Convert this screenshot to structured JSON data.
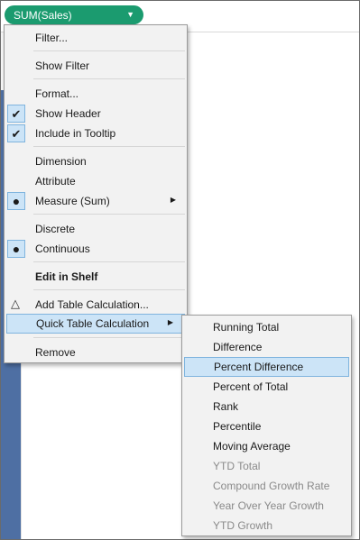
{
  "pill": {
    "label": "SUM(Sales)",
    "accent": "#1b9b6f"
  },
  "context_menu": {
    "items": {
      "filter": "Filter...",
      "show_filter": "Show Filter",
      "format": "Format...",
      "show_header": "Show Header",
      "include_tooltip": "Include in Tooltip",
      "dimension": "Dimension",
      "attribute": "Attribute",
      "measure": "Measure (Sum)",
      "discrete": "Discrete",
      "continuous": "Continuous",
      "edit_in_shelf": "Edit in Shelf",
      "add_table_calc": "Add Table Calculation...",
      "quick_table_calc": "Quick Table Calculation",
      "remove": "Remove"
    },
    "checked": [
      "Show Header",
      "Include in Tooltip"
    ],
    "selected_radio": [
      "Measure (Sum)",
      "Continuous"
    ],
    "highlighted": "Quick Table Calculation"
  },
  "submenu": {
    "items": [
      {
        "label": "Running Total",
        "enabled": true
      },
      {
        "label": "Difference",
        "enabled": true
      },
      {
        "label": "Percent Difference",
        "enabled": true,
        "highlighted": true
      },
      {
        "label": "Percent of Total",
        "enabled": true
      },
      {
        "label": "Rank",
        "enabled": true
      },
      {
        "label": "Percentile",
        "enabled": true
      },
      {
        "label": "Moving Average",
        "enabled": true
      },
      {
        "label": "YTD Total",
        "enabled": false
      },
      {
        "label": "Compound Growth Rate",
        "enabled": false
      },
      {
        "label": "Year Over Year Growth",
        "enabled": false
      },
      {
        "label": "YTD Growth",
        "enabled": false
      }
    ]
  },
  "icons": {
    "pill_dropdown": "triangle-down-icon",
    "check": "check-icon",
    "radio": "radio-bullet-icon",
    "table_calc": "delta-triangle-icon",
    "submenu": "triangle-right-icon"
  }
}
